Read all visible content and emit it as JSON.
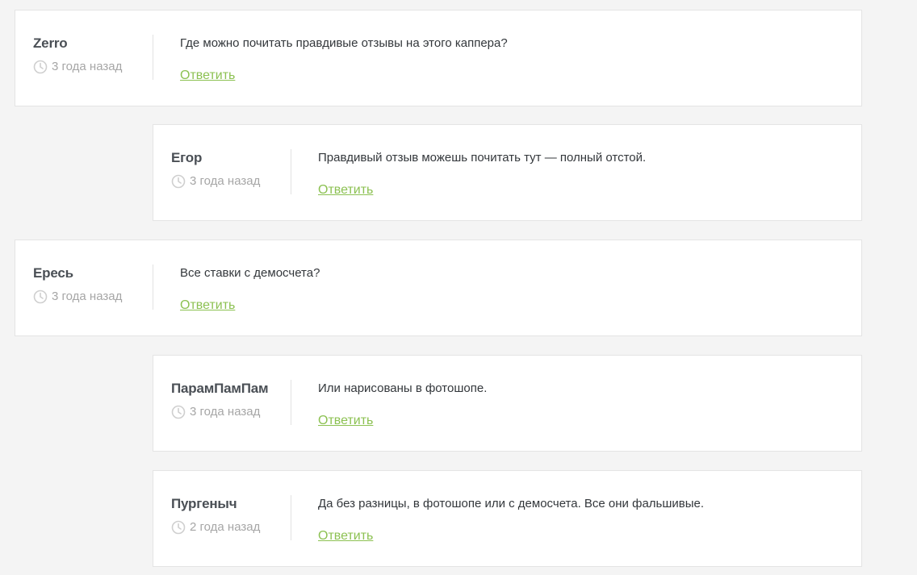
{
  "comments": [
    {
      "author": "Zerro",
      "date": "3 года назад",
      "text": "Где можно почитать правдивые отзывы на этого каппера?",
      "reply_label": "Ответить"
    },
    {
      "author": "Егор",
      "date": "3 года назад",
      "text": "Правдивый отзыв можешь почитать тут — полный отстой.",
      "reply_label": "Ответить"
    },
    {
      "author": "Ересь",
      "date": "3 года назад",
      "text": "Все ставки с демосчета?",
      "reply_label": "Ответить"
    },
    {
      "author": "ПарамПамПам",
      "date": "3 года назад",
      "text": "Или нарисованы в фотошопе.",
      "reply_label": "Ответить"
    },
    {
      "author": "Пургеныч",
      "date": "2 года назад",
      "text": "Да без разницы, в фотошопе или с демосчета. Все они фальшивые.",
      "reply_label": "Ответить"
    }
  ],
  "icons": {
    "date": "clock-icon"
  },
  "colors": {
    "accent": "#8cc152",
    "background": "#f4f4f4",
    "card": "#ffffff"
  }
}
